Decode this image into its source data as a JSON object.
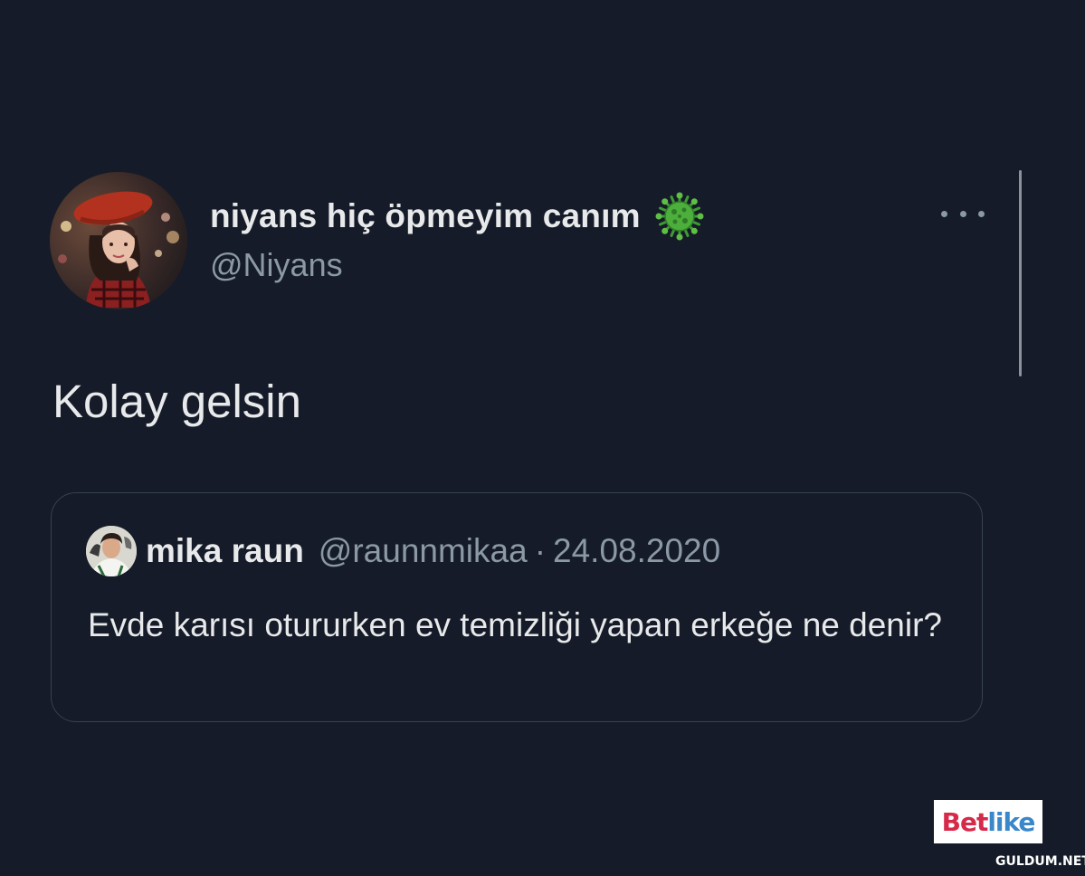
{
  "tweet": {
    "display_name": "niyans hiç öpmeyim canım",
    "name_emoji": "virus-icon",
    "handle": "@Niyans",
    "text": "Kolay gelsin",
    "more_icon": "more-horizontal-icon"
  },
  "quoted_tweet": {
    "display_name": "mika raun",
    "handle": "@raunnmikaa",
    "separator": "·",
    "date": "24.08.2020",
    "text": "Evde karısı otururken ev temizliği yapan erkeğe ne denir?"
  },
  "watermarks": {
    "brand_part1": "Bet",
    "brand_part2": "like",
    "site": "GULDUM.NET"
  },
  "colors": {
    "background": "#151b28",
    "text_primary": "#e7e9ea",
    "text_secondary": "#8b98a5",
    "border": "#38424f",
    "virus_green": "#4caf3c"
  }
}
